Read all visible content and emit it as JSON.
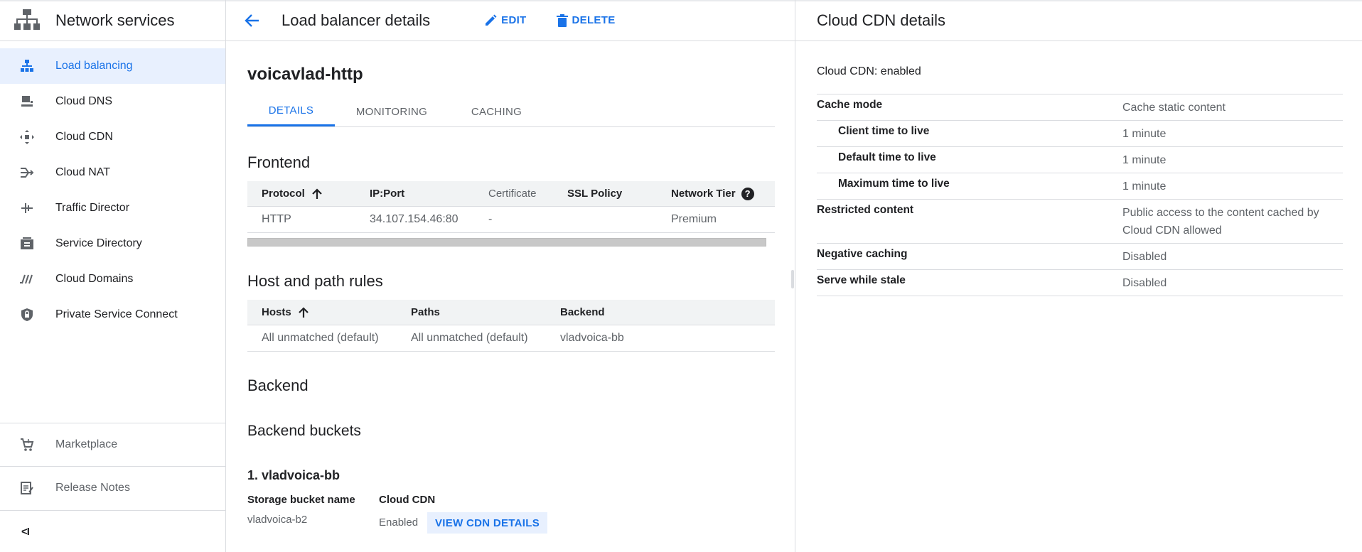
{
  "sidebar": {
    "title": "Network services",
    "items": [
      {
        "label": "Load balancing",
        "icon": "load-balancing-icon",
        "active": true
      },
      {
        "label": "Cloud DNS",
        "icon": "cloud-dns-icon"
      },
      {
        "label": "Cloud CDN",
        "icon": "cloud-cdn-icon"
      },
      {
        "label": "Cloud NAT",
        "icon": "cloud-nat-icon"
      },
      {
        "label": "Traffic Director",
        "icon": "traffic-director-icon"
      },
      {
        "label": "Service Directory",
        "icon": "service-directory-icon"
      },
      {
        "label": "Cloud Domains",
        "icon": "cloud-domains-icon"
      },
      {
        "label": "Private Service Connect",
        "icon": "private-service-connect-icon"
      }
    ],
    "bottom": [
      {
        "label": "Marketplace",
        "icon": "cart-icon"
      },
      {
        "label": "Release Notes",
        "icon": "release-notes-icon"
      }
    ],
    "collapse_label": "<I"
  },
  "header": {
    "title": "Load balancer details",
    "edit_label": "EDIT",
    "delete_label": "DELETE"
  },
  "lb": {
    "name": "voicavlad-http",
    "tabs": [
      "DETAILS",
      "MONITORING",
      "CACHING"
    ],
    "active_tab": "DETAILS"
  },
  "frontend": {
    "heading": "Frontend",
    "columns": [
      "Protocol",
      "IP:Port",
      "Certificate",
      "SSL Policy",
      "Network Tier"
    ],
    "rows": [
      [
        "HTTP",
        "34.107.154.46:80",
        "-",
        "",
        "Premium"
      ]
    ],
    "help_glyph": "?"
  },
  "host_rules": {
    "heading": "Host and path rules",
    "columns": [
      "Hosts",
      "Paths",
      "Backend"
    ],
    "rows": [
      [
        "All unmatched (default)",
        "All unmatched (default)",
        "vladvoica-bb"
      ]
    ]
  },
  "backend": {
    "heading": "Backend",
    "buckets_heading": "Backend buckets",
    "bucket_title": "1. vladvoica-bb",
    "storage_label": "Storage bucket name",
    "storage_value": "vladvoica-b2",
    "cdn_label": "Cloud CDN",
    "cdn_value": "Enabled",
    "cdn_button": "VIEW CDN DETAILS"
  },
  "cdn_panel": {
    "title": "Cloud CDN details",
    "status": "Cloud CDN: enabled",
    "rows": [
      {
        "key": "Cache mode",
        "value": "Cache static content"
      },
      {
        "key": "Client time to live",
        "value": "1 minute"
      },
      {
        "key": "Default time to live",
        "value": "1 minute"
      },
      {
        "key": "Maximum time to live",
        "value": "1 minute"
      },
      {
        "key": "Restricted content",
        "value": "Public access to the content cached by Cloud CDN allowed"
      },
      {
        "key": "Negative caching",
        "value": "Disabled"
      },
      {
        "key": "Serve while stale",
        "value": "Disabled"
      }
    ]
  },
  "colors": {
    "accent": "#1a73e8",
    "active_bg": "#e8f0fe",
    "border": "#dadce0",
    "muted_text": "#5f6368"
  }
}
